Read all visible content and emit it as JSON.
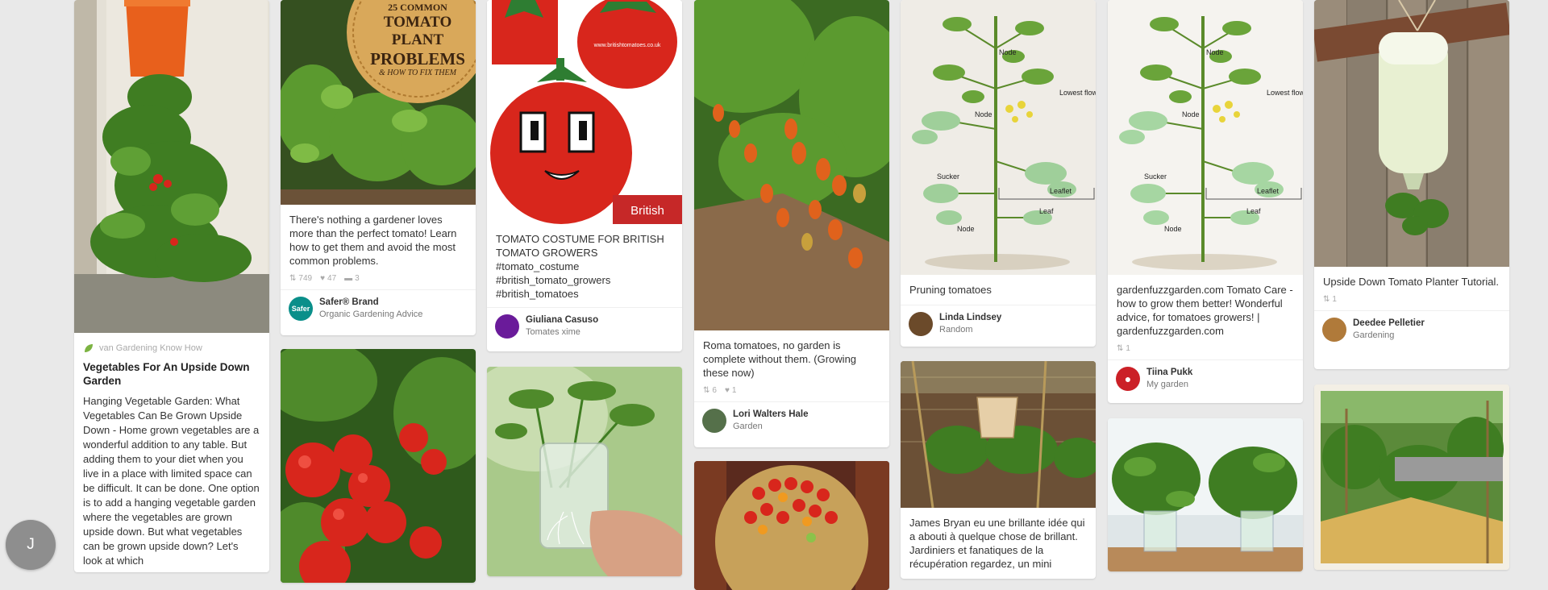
{
  "user": {
    "initial": "J"
  },
  "pins": {
    "upside_down_garden": {
      "via": "van Gardening Know How",
      "title": "Vegetables For An Upside Down Garden",
      "description": "Hanging Vegetable Garden: What Vegetables Can Be Grown Upside Down - Home grown vegetables are a wonderful addition to any table. But adding them to your diet when you live in a place with limited space can be difficult. It can be done. One option is to add a hanging vegetable garden where the vegetables are grown upside down. But what vegetables can be grown upside down? Let's look at which"
    },
    "problems": {
      "overlay_line1": "25 COMMON",
      "overlay_line2": "TOMATO PLANT",
      "overlay_line3": "PROBLEMS",
      "overlay_line4": "& HOW TO FIX THEM",
      "description": "There's nothing a gardener loves more than the perfect tomato! Learn how to get them and avoid the most common problems.",
      "repins": "749",
      "likes": "47",
      "comments": "3",
      "user_name": "Safer® Brand",
      "board": "Organic Gardening Advice",
      "avatar_text": "Safer"
    },
    "costume": {
      "description": "TOMATO COSTUME FOR BRITISH TOMATO GROWERS #tomato_costume #british_tomato_growers #british_tomatoes",
      "user_name": "Giuliana Casuso",
      "board": "Tomates xime",
      "url_text": "www.britishtomatoes.co.uk",
      "badge_text": "British"
    },
    "roma": {
      "description": "Roma tomatoes, no garden is complete without them. (Growing these now)",
      "repins": "6",
      "likes": "1",
      "user_name": "Lori Walters Hale",
      "board": "Garden"
    },
    "pruning": {
      "description": "Pruning tomatoes",
      "user_name": "Linda Lindsey",
      "board": "Random"
    },
    "fuzzgarden": {
      "description": "gardenfuzzgarden.com Tomato Care - how to grow them better! Wonderful advice, for tomatoes growers! | gardenfuzzgarden.com",
      "repins": "1",
      "user_name": "Tiina Pukk",
      "board": "My garden"
    },
    "planter": {
      "description": "Upside Down Tomato Planter Tutorial.",
      "repins": "1",
      "user_name": "Deedee Pelletier",
      "board": "Gardening"
    },
    "bryan": {
      "description": "James Bryan eu une brillante idée qui a abouti à quelque chose de brillant. Jardiniers et fanatiques de la récupération regardez, un mini"
    }
  },
  "diagram_labels": {
    "node": "Node",
    "lowest_flower_cluster": "Lowest flower cluster",
    "sucker": "Sucker",
    "leaflet": "Leaflet",
    "leaf": "Leaf"
  },
  "colors": {
    "background": "#e9e9e9",
    "tomato_red": "#d8261c",
    "leaf_green": "#4f8a2b",
    "pinterest_red": "#cb2027",
    "safer_teal": "#0a8f8a"
  }
}
